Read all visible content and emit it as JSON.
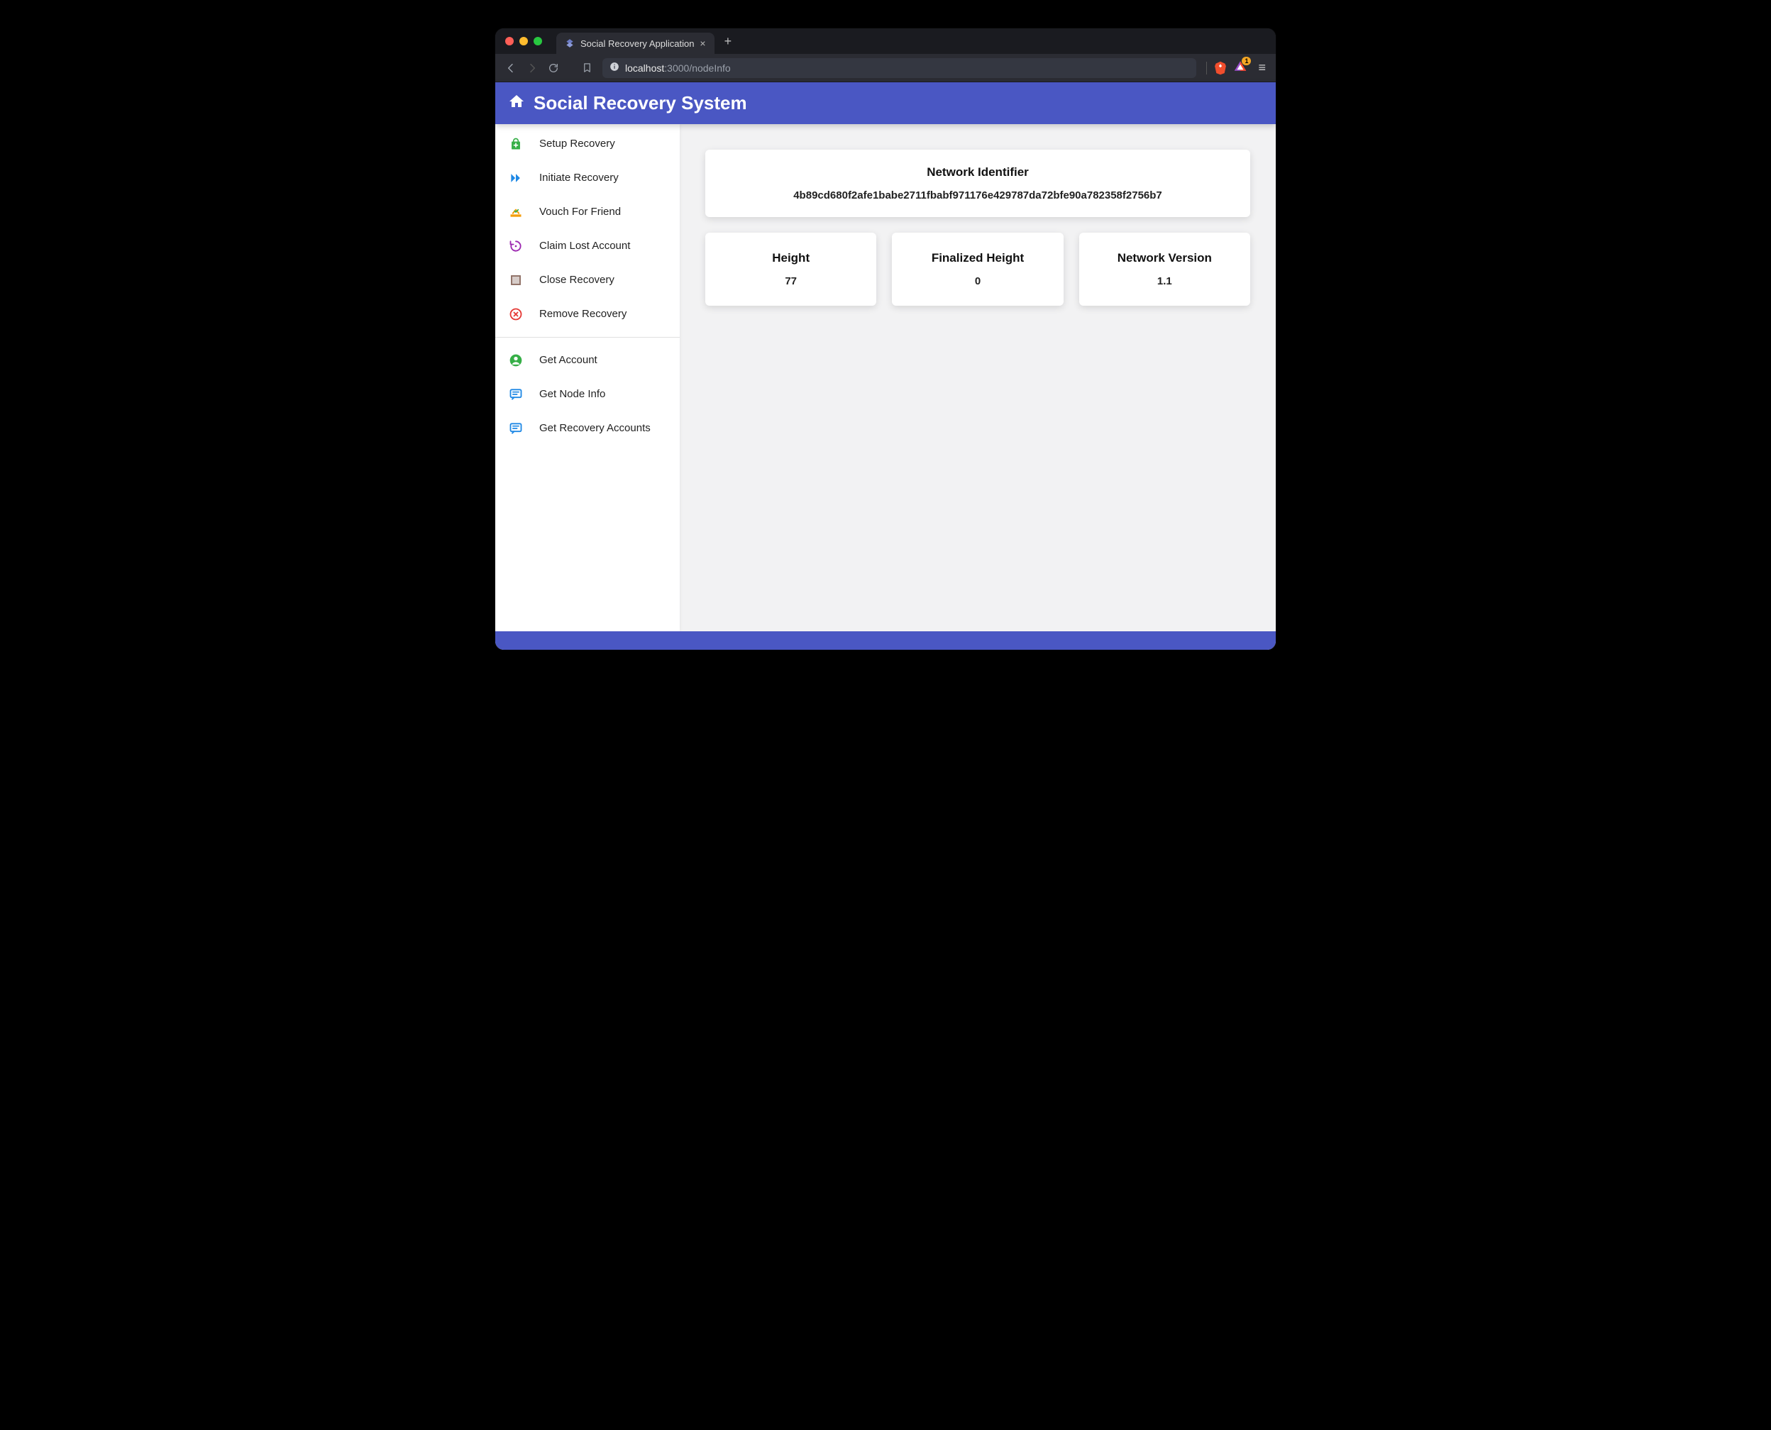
{
  "browser": {
    "tab_title": "Social Recovery Application",
    "url_host": "localhost",
    "url_port": "3000",
    "url_path": "/nodeInfo",
    "bat_badge": "1"
  },
  "header": {
    "title": "Social Recovery System"
  },
  "sidebar": {
    "group1": [
      {
        "label": "Setup Recovery"
      },
      {
        "label": "Initiate Recovery"
      },
      {
        "label": "Vouch For Friend"
      },
      {
        "label": "Claim Lost Account"
      },
      {
        "label": "Close Recovery"
      },
      {
        "label": "Remove Recovery"
      }
    ],
    "group2": [
      {
        "label": "Get Account"
      },
      {
        "label": "Get Node Info"
      },
      {
        "label": "Get Recovery Accounts"
      }
    ]
  },
  "main": {
    "network_identifier": {
      "title": "Network Identifier",
      "value": "4b89cd680f2afe1babe2711fbabf971176e429787da72bfe90a782358f2756b7"
    },
    "stats": [
      {
        "title": "Height",
        "value": "77"
      },
      {
        "title": "Finalized Height",
        "value": "0"
      },
      {
        "title": "Network Version",
        "value": "1.1"
      }
    ]
  }
}
